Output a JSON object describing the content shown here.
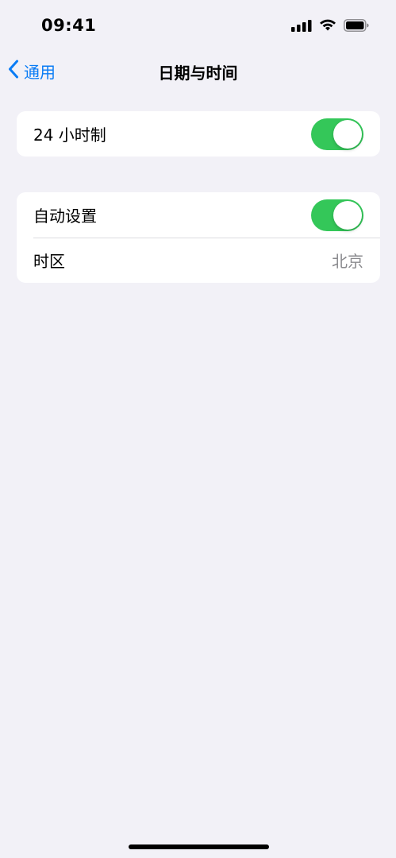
{
  "status_bar": {
    "time": "09:41"
  },
  "nav": {
    "back_label": "通用",
    "title": "日期与时间"
  },
  "settings": {
    "group1": {
      "hour24": {
        "label": "24 小时制",
        "enabled": true
      }
    },
    "group2": {
      "auto_set": {
        "label": "自动设置",
        "enabled": true
      },
      "timezone": {
        "label": "时区",
        "value": "北京"
      }
    }
  },
  "colors": {
    "accent": "#0a7cf5",
    "toggle_on": "#34c759",
    "background": "#f2f1f7",
    "secondary_text": "#8a8a8e"
  },
  "icons": {
    "back": "chevron-left-icon",
    "signal": "cellular-signal-icon",
    "wifi": "wifi-icon",
    "battery": "battery-icon"
  }
}
